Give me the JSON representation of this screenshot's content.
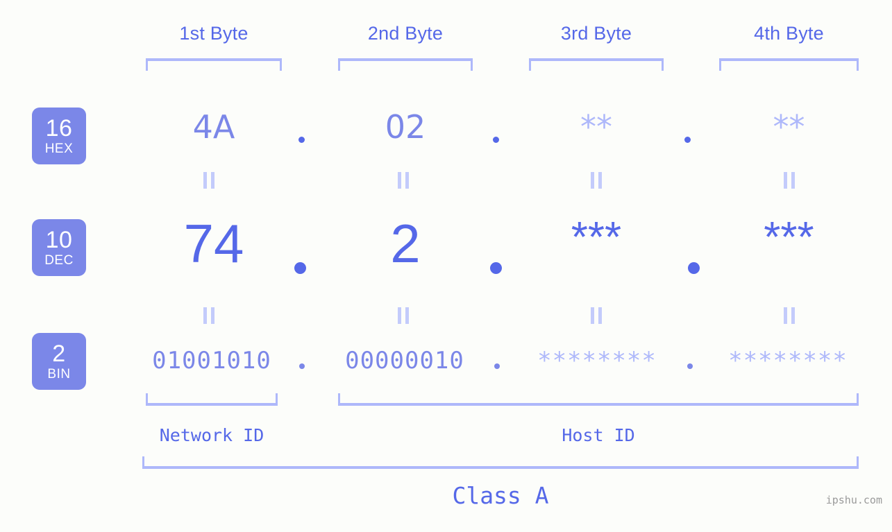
{
  "watermark": "ipshu.com",
  "byte_headers": [
    {
      "label": "1st Byte"
    },
    {
      "label": "2nd Byte"
    },
    {
      "label": "3rd Byte"
    },
    {
      "label": "4th Byte"
    }
  ],
  "bases": [
    {
      "number": "16",
      "name": "HEX"
    },
    {
      "number": "10",
      "name": "DEC"
    },
    {
      "number": "2",
      "name": "BIN"
    }
  ],
  "rows": {
    "hex": {
      "base_number": "16",
      "base_name": "HEX",
      "values": [
        "4A",
        "02",
        "**",
        "**"
      ],
      "separator": "."
    },
    "dec": {
      "base_number": "10",
      "base_name": "DEC",
      "values": [
        "74",
        "2",
        "***",
        "***"
      ],
      "separator": "."
    },
    "bin": {
      "base_number": "2",
      "base_name": "BIN",
      "values": [
        "01001010",
        "00000010",
        "********",
        "********"
      ],
      "separator": "."
    }
  },
  "equality_symbol": "=",
  "segments": {
    "network_id": "Network ID",
    "host_id": "Host ID",
    "class": "Class A"
  },
  "colors": {
    "background": "#fcfdfa",
    "accent_strong": "#5568e8",
    "accent_mid": "#7b87e8",
    "accent_light": "#aeb8fa",
    "badge_fill": "#7b87e8",
    "badge_text": "#ffffff",
    "watermark_text": "#9a9a9a"
  }
}
